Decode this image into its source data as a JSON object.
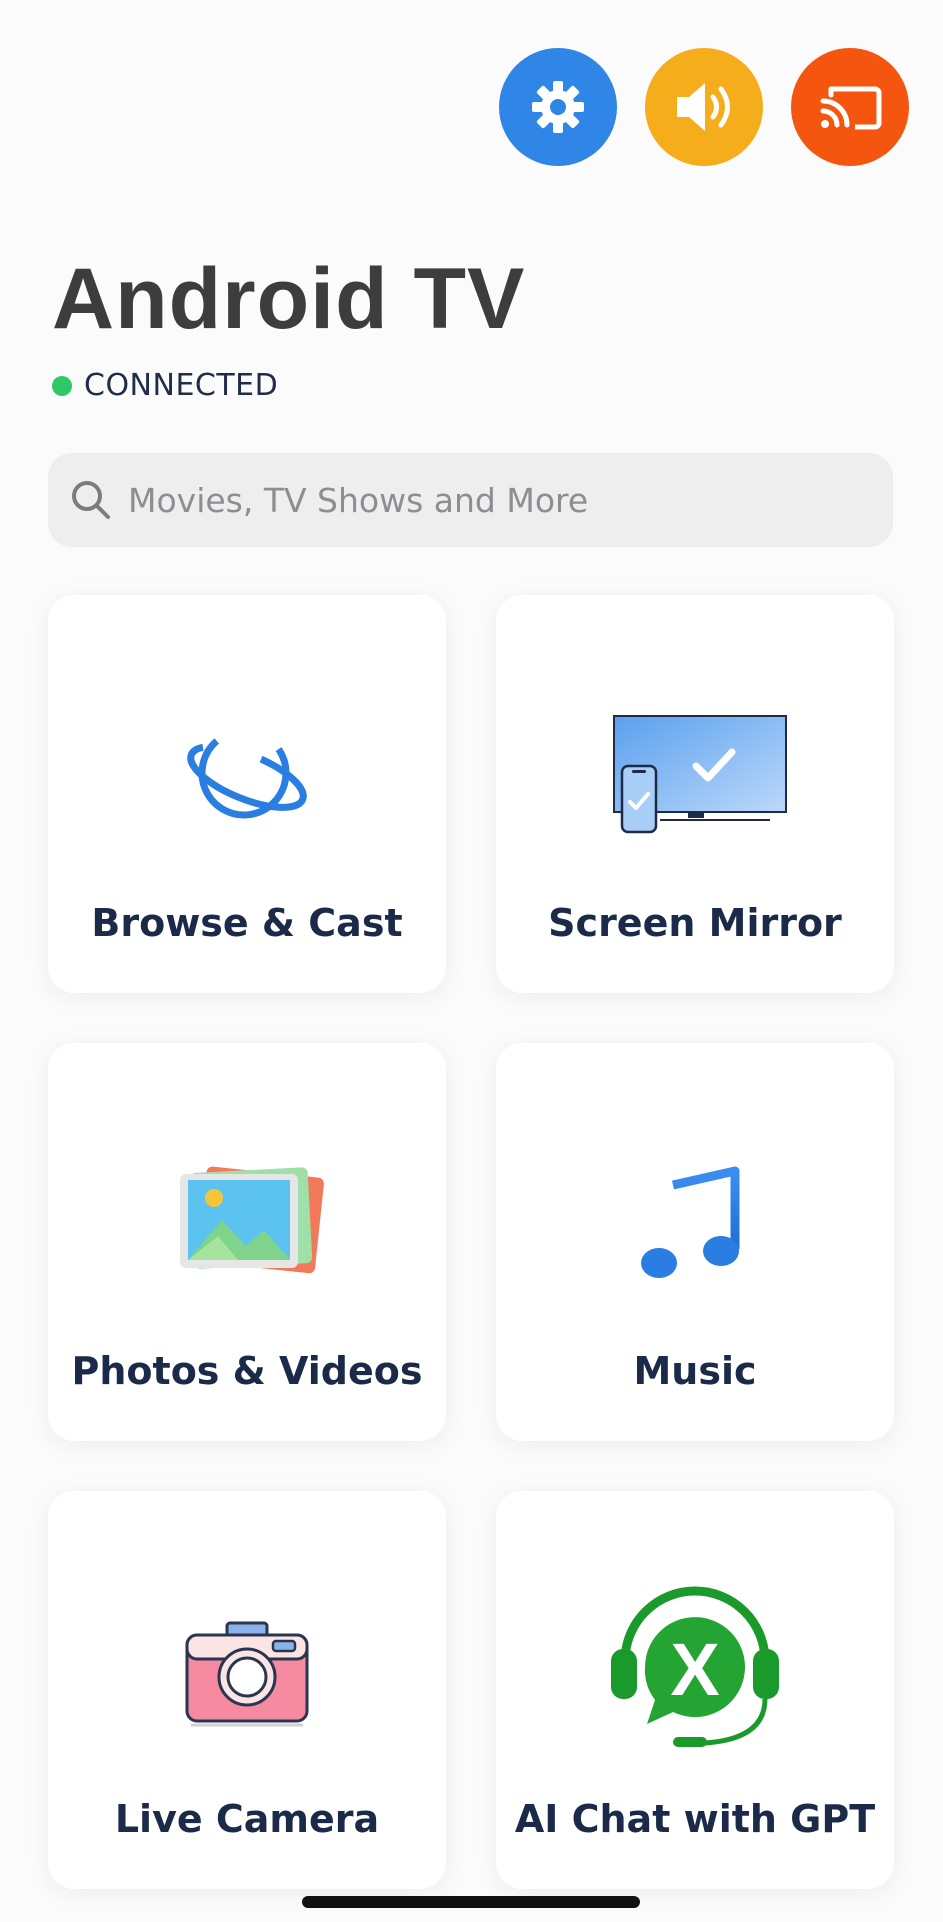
{
  "top_actions": [
    {
      "name": "settings",
      "icon": "gear-icon",
      "color": "#2f86e6"
    },
    {
      "name": "volume",
      "icon": "speaker-icon",
      "color": "#f6ad1c"
    },
    {
      "name": "cast",
      "icon": "cast-icon",
      "color": "#f4560f"
    }
  ],
  "device": {
    "title": "Android TV",
    "status": "CONNECTED",
    "status_color": "#2ec866"
  },
  "search": {
    "placeholder": "Movies, TV Shows and More",
    "value": ""
  },
  "tiles": [
    {
      "label": "Browse & Cast",
      "icon": "globe-orbit-icon"
    },
    {
      "label": "Screen Mirror",
      "icon": "screen-mirror-icon"
    },
    {
      "label": "Photos & Videos",
      "icon": "photos-icon"
    },
    {
      "label": "Music",
      "icon": "music-note-icon"
    },
    {
      "label": "Live Camera",
      "icon": "camera-icon"
    },
    {
      "label": "AI Chat with GPT",
      "icon": "ai-chat-headset-icon"
    }
  ],
  "colors": {
    "title": "#3d3d3d",
    "label": "#1a2a48",
    "search_bg": "#eeeeef"
  }
}
